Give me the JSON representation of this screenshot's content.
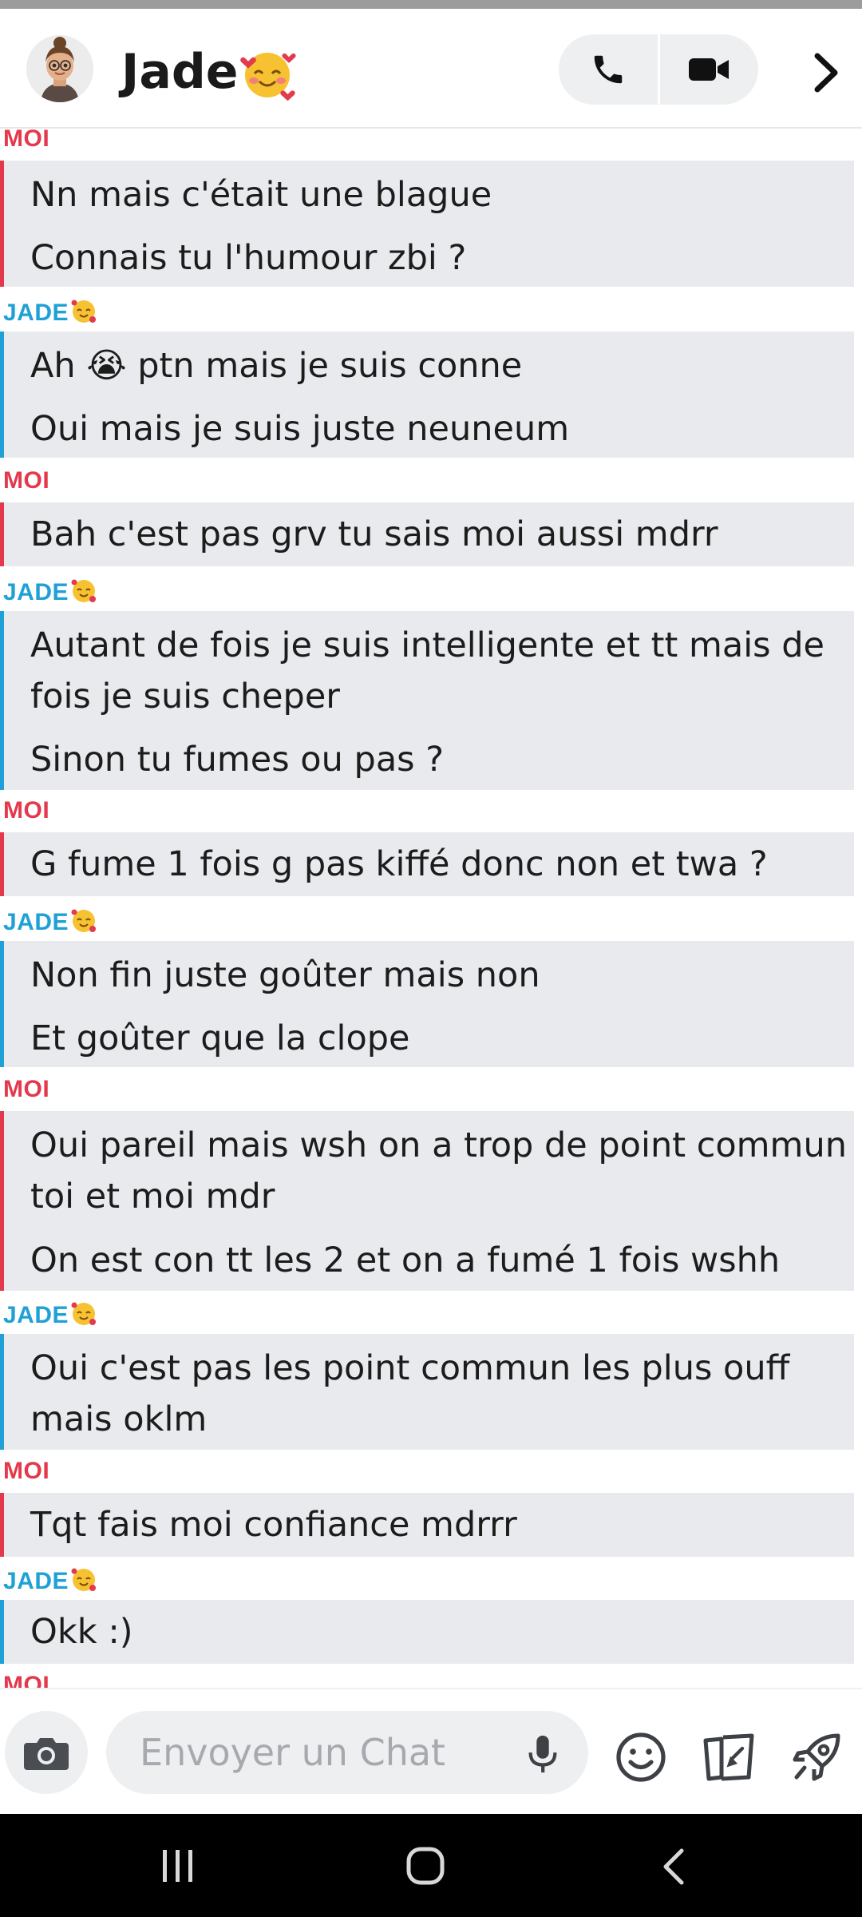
{
  "header": {
    "contact_name": "Jade",
    "call_icon": "phone-icon",
    "video_icon": "video-icon",
    "more_icon": "chevron-right-icon"
  },
  "thread": {
    "top_cut_label": "MOI",
    "bottom_cut_label": "MOI",
    "groups": [
      {
        "sender": "MOI",
        "from": "me",
        "messages": [
          "Nn mais c'était une blague",
          "Connais tu l'humour zbi ?"
        ]
      },
      {
        "sender": "JADE",
        "from": "her",
        "messages": [
          "Ah 😭 ptn mais je suis conne",
          "Oui mais je suis juste neuneum"
        ]
      },
      {
        "sender": "MOI",
        "from": "me",
        "messages": [
          "Bah c'est pas grv tu sais moi aussi mdrr"
        ]
      },
      {
        "sender": "JADE",
        "from": "her",
        "messages": [
          "Autant de fois je suis intelligente et tt mais de fois je suis cheper",
          "Sinon tu fumes ou pas ?"
        ]
      },
      {
        "sender": "MOI",
        "from": "me",
        "messages": [
          "G fume 1 fois g pas kiffé donc non et twa ?"
        ]
      },
      {
        "sender": "JADE",
        "from": "her",
        "messages": [
          "Non fin juste goûter mais non",
          "Et goûter que la clope"
        ]
      },
      {
        "sender": "MOI",
        "from": "me",
        "messages": [
          "Oui pareil mais wsh on a trop de point commun toi et moi mdr",
          "On est con tt les 2 et on a fumé  1 fois wshh"
        ]
      },
      {
        "sender": "JADE",
        "from": "her",
        "messages": [
          "Oui c'est pas les point commun les plus ouff mais oklm"
        ]
      },
      {
        "sender": "MOI",
        "from": "me",
        "messages": [
          "Tqt fais moi confiance mdrrr"
        ]
      },
      {
        "sender": "JADE",
        "from": "her",
        "messages": [
          "Okk :)"
        ]
      }
    ]
  },
  "composer": {
    "placeholder": "Envoyer un Chat",
    "camera_icon": "camera-icon",
    "mic_icon": "microphone-icon",
    "emoji_icon": "smiley-icon",
    "cards_icon": "cards-icon",
    "rocket_icon": "rocket-icon"
  },
  "colors": {
    "me": "#e4384c",
    "her": "#1fa1d5",
    "bubble_bg": "#e9eaed"
  }
}
